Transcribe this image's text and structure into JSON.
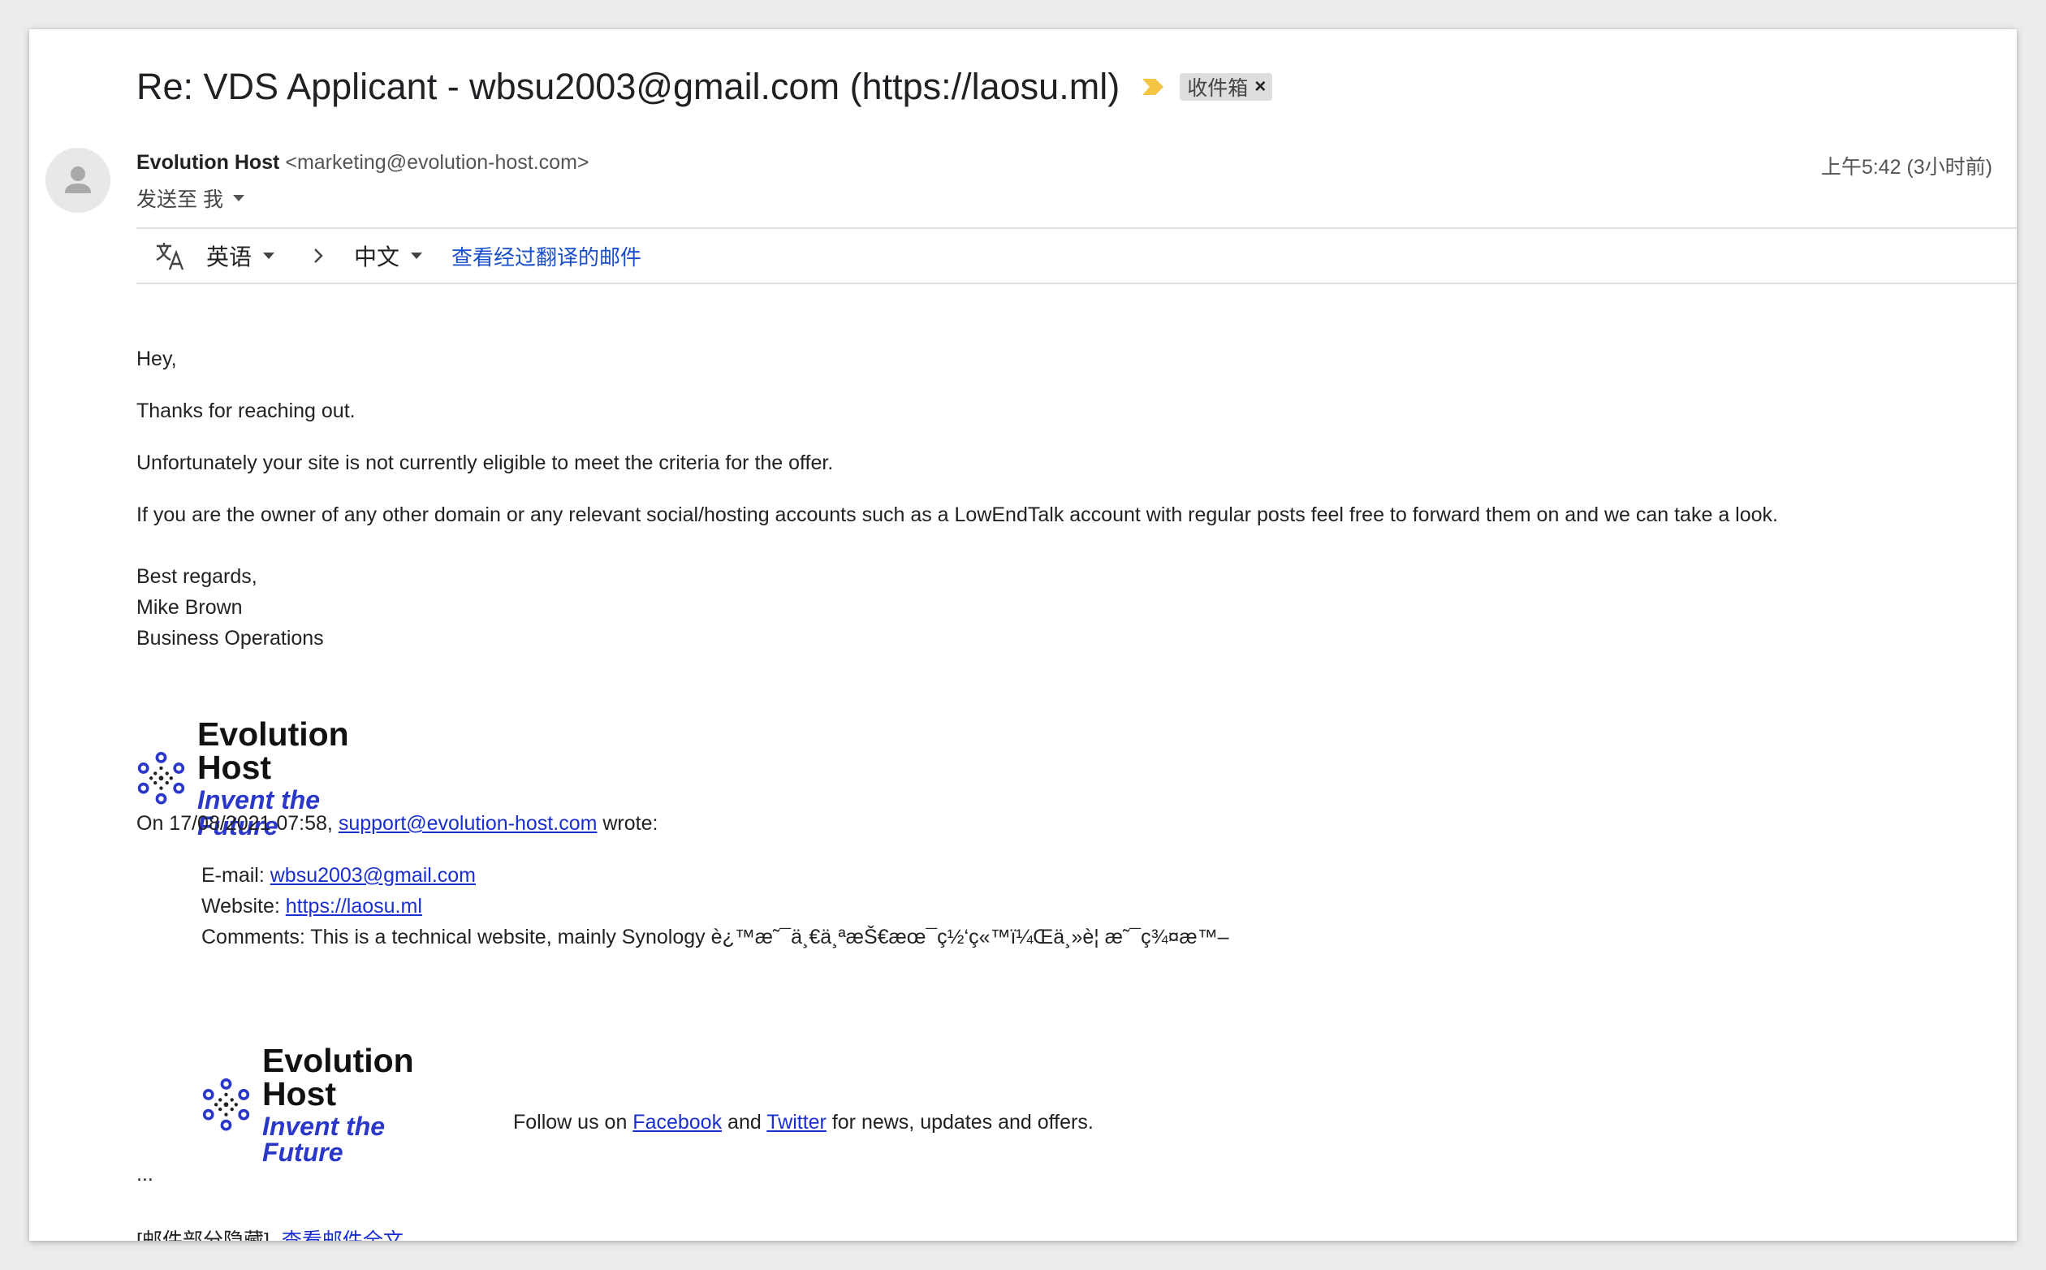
{
  "email": {
    "subject": "Re: VDS Applicant - wbsu2003@gmail.com (https://laosu.ml)",
    "label": "收件箱",
    "label_close": "×",
    "sender_name": "Evolution Host",
    "sender_email": "<marketing@evolution-host.com>",
    "to_line": "发送至 我",
    "time": "上午5:42 (3小时前)"
  },
  "translate": {
    "from_lang": "英语",
    "to_lang": "中文",
    "view_link": "查看经过翻译的邮件"
  },
  "body": {
    "greeting": "Hey,",
    "line1": "Thanks for reaching out.",
    "line2": "Unfortunately your site is not currently eligible to meet the criteria for the offer.",
    "line3": "If you are the owner of any other domain or any relevant social/hosting accounts such as a LowEndTalk account with regular posts feel free to forward them on and we can take a look.",
    "sign1": "Best regards,",
    "sign2": "Mike Brown",
    "sign3": "Business Operations"
  },
  "logo": {
    "title": "Evolution Host",
    "subtitle": "Invent the Future"
  },
  "quote": {
    "intro_prefix": "On 17/08/2021 07:58, ",
    "intro_link": "support@evolution-host.com",
    "intro_suffix": " wrote:",
    "email_label": "E-mail: ",
    "email_link": "wbsu2003@gmail.com",
    "website_label": "Website: ",
    "website_link": "https://laosu.ml",
    "comments": "Comments: This is a technical website, mainly Synology è¿™æ˜¯ä¸€ä¸ªæŠ€æœ¯ç½‘ç«™ï¼Œä¸»è¦ æ˜¯ç¾¤æ™–",
    "follow_prefix": "Follow us on ",
    "facebook": "Facebook",
    "follow_and": " and ",
    "twitter": "Twitter",
    "follow_suffix": " for news, updates and offers."
  },
  "footer": {
    "ellipsis": "...",
    "hidden_note": "[邮件部分隐藏]",
    "view_full": "查看邮件全文"
  },
  "colors": {
    "link": "#1a2fd0",
    "translate_link": "#1a4fcb",
    "importance": "#f4c542",
    "logo_blue": "#2a37c8"
  }
}
